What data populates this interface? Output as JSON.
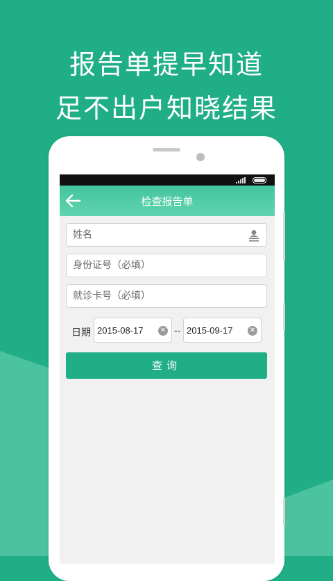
{
  "promo": {
    "line1": "报告单提早知道",
    "line2": "足不出户知晓结果"
  },
  "colors": {
    "brand_green": "#1fae86",
    "appbar_gradient_top": "#44c59d",
    "appbar_gradient_bottom": "#5fd4ae"
  },
  "appbar": {
    "title": "检查报告单",
    "back_icon": "back-arrow-icon"
  },
  "form": {
    "name_placeholder": "姓名",
    "name_icon": "contact-card-icon",
    "id_placeholder": "身份证号（必填）",
    "card_placeholder": "就诊卡号（必填）",
    "date_label": "日期",
    "date_from": "2015-08-17",
    "date_separator": "--",
    "date_to": "2015-09-17",
    "clear_icon": "clear-circle-icon",
    "clear_glyph": "✕",
    "submit_label": "查询"
  }
}
